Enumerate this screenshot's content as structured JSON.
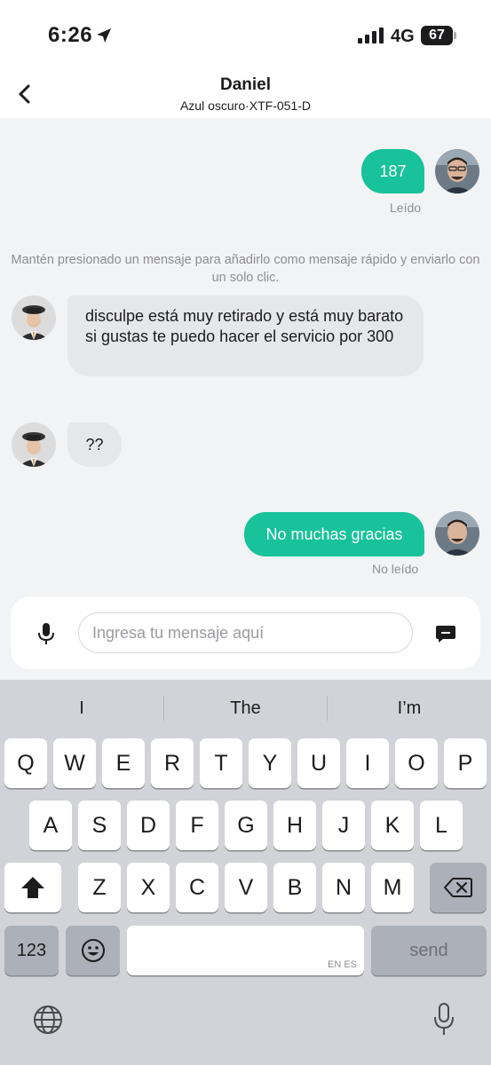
{
  "status_bar": {
    "time": "6:26",
    "network": "4G",
    "battery": "67"
  },
  "header": {
    "name": "Daniel",
    "subtitle": "Azul oscuro·XTF-051-D"
  },
  "messages": [
    {
      "direction": "out",
      "text": "187",
      "status": "Leído"
    },
    {
      "direction": "in",
      "text": "disculpe está muy retirado y está muy barato si gustas te puedo hacer el servicio por 300"
    },
    {
      "direction": "in",
      "text": "??"
    },
    {
      "direction": "out",
      "text": "No muchas gracias",
      "status": "No leído"
    }
  ],
  "hint": "Mantén presionado un mensaje para añadirlo como mensaje rápido y enviarlo con un solo clic.",
  "input": {
    "placeholder": "Ingresa tu mensaje aquí",
    "value": ""
  },
  "keyboard": {
    "suggestions": [
      "I",
      "The",
      "I’m"
    ],
    "row1": [
      "Q",
      "W",
      "E",
      "R",
      "T",
      "Y",
      "U",
      "I",
      "O",
      "P"
    ],
    "row2": [
      "A",
      "S",
      "D",
      "F",
      "G",
      "H",
      "J",
      "K",
      "L"
    ],
    "row3": [
      "Z",
      "X",
      "C",
      "V",
      "B",
      "N",
      "M"
    ],
    "numbers_key": "123",
    "space_languages": "EN ES",
    "send_key": "send"
  },
  "colors": {
    "accent": "#18c29a",
    "incoming_bubble": "#e6e7e9",
    "background": "#f2f3f5",
    "keyboard": "#d1d3d9"
  }
}
